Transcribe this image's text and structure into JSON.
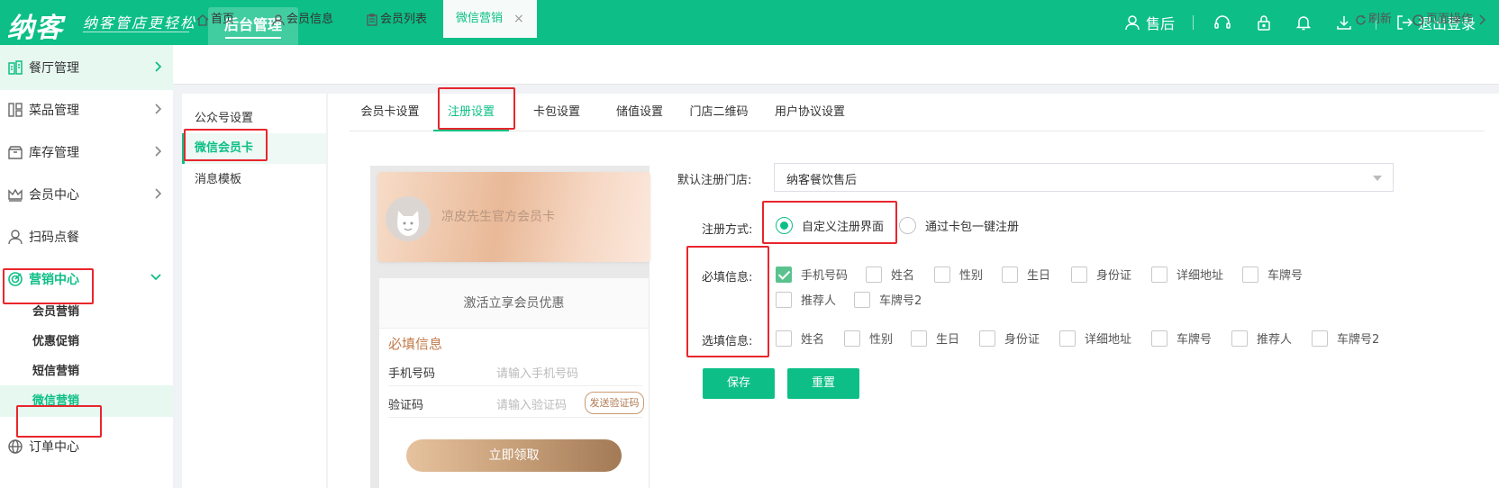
{
  "colors": {
    "brand": "#0dbf86",
    "highlight": "#e8262c"
  },
  "header": {
    "logo": "纳客",
    "slogan": "纳客管店更轻松",
    "nav_tab": "后台管理",
    "user": "售后",
    "logout": "退出登录",
    "icons": [
      "user-icon",
      "headset-icon",
      "lock-icon",
      "bell-icon",
      "download-icon",
      "logout-icon"
    ]
  },
  "sidebar": {
    "items": [
      {
        "label": "餐厅管理",
        "icon": "restaurant-icon"
      },
      {
        "label": "菜品管理",
        "icon": "dishes-icon"
      },
      {
        "label": "库存管理",
        "icon": "inventory-icon"
      },
      {
        "label": "会员中心",
        "icon": "crown-icon"
      },
      {
        "label": "扫码点餐",
        "icon": "person-icon"
      },
      {
        "label": "营销中心",
        "icon": "target-icon"
      },
      {
        "label": "订单中心",
        "icon": "globe-icon"
      }
    ],
    "subitems": [
      "会员营销",
      "优惠促销",
      "短信营销",
      "微信营销"
    ]
  },
  "page_tabs": {
    "items": [
      "首页",
      "会员信息",
      "会员列表",
      "微信营销"
    ],
    "close": "×",
    "refresh": "刷新",
    "page_ops": "页面操作"
  },
  "left_menu": [
    "公众号设置",
    "微信会员卡",
    "消息模板"
  ],
  "sub_tabs": [
    "会员卡设置",
    "注册设置",
    "卡包设置",
    "储值设置",
    "门店二维码",
    "用户协议设置"
  ],
  "preview": {
    "card_name": "凉皮先生官方会员卡",
    "activate_title": "激活立享会员优惠",
    "required_heading": "必填信息",
    "phone_label": "手机号码",
    "phone_placeholder": "请输入手机号码",
    "code_label": "验证码",
    "code_placeholder": "请输入验证码",
    "send_code": "发送验证码",
    "claim": "立即领取"
  },
  "form": {
    "default_store_label": "默认注册门店:",
    "default_store_value": "纳客餐饮售后",
    "method_label": "注册方式:",
    "method_options": [
      "自定义注册界面",
      "通过卡包一键注册"
    ],
    "method_selected": 0,
    "required_label": "必填信息:",
    "required_options": [
      "手机号码",
      "姓名",
      "性别",
      "生日",
      "身份证",
      "详细地址",
      "车牌号",
      "推荐人",
      "车牌号2"
    ],
    "required_checked": [
      true,
      false,
      false,
      false,
      false,
      false,
      false,
      false,
      false
    ],
    "optional_label": "选填信息:",
    "optional_options": [
      "姓名",
      "性别",
      "生日",
      "身份证",
      "详细地址",
      "车牌号",
      "推荐人",
      "车牌号2"
    ],
    "optional_checked": [
      false,
      false,
      false,
      false,
      false,
      false,
      false,
      false
    ],
    "save": "保存",
    "reset": "重置"
  }
}
